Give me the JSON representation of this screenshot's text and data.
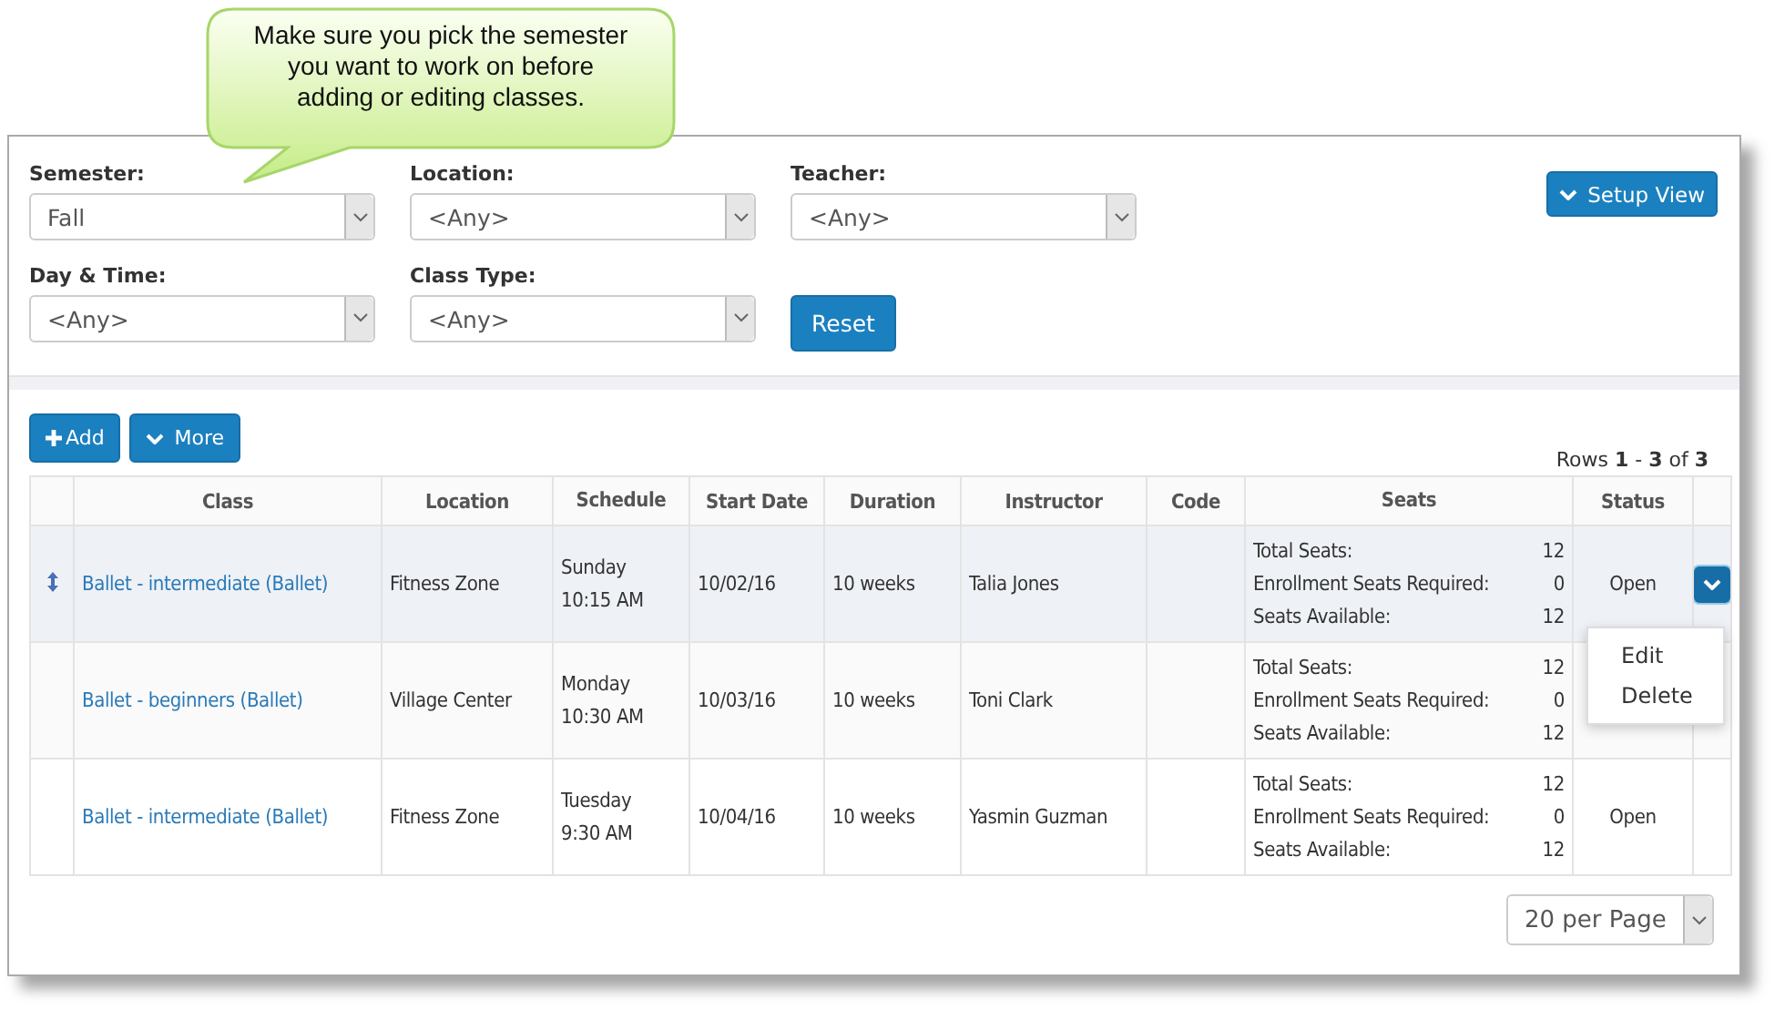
{
  "callout": {
    "text": "Make sure you pick the semester you want to work on before adding or editing classes."
  },
  "filters": [
    {
      "label": "Semester:",
      "value": "Fall"
    },
    {
      "label": "Location:",
      "value": "<Any>"
    },
    {
      "label": "Teacher:",
      "value": "<Any>"
    },
    {
      "label": "Day & Time:",
      "value": "<Any>"
    },
    {
      "label": "Class Type:",
      "value": "<Any>"
    }
  ],
  "reset_button": "Reset",
  "setup_view_button": "Setup View",
  "toolbar": {
    "add_button": "Add",
    "more_button": "More",
    "rows_info": "Rows **1** - **3** of **3**"
  },
  "table": {
    "columns": [
      "Class",
      "Location",
      "Schedule",
      "Start Date",
      "Duration",
      "Instructor",
      "Code",
      "Seats",
      "Status"
    ],
    "rows": [
      {
        "selected": true,
        "class": "Ballet - intermediate (Ballet)",
        "location": "Fitness Zone",
        "schedule": [
          "Sunday",
          "10:15 AM"
        ],
        "start_date": "10/02/16",
        "duration": "10 weeks",
        "instructor": "Talia Jones",
        "seats": [
          {
            "label": "Total Seats:",
            "value": "12"
          },
          {
            "label": "Enrollment Seats Required:",
            "value": "0"
          },
          {
            "label": "Seats Available:",
            "value": "12"
          }
        ],
        "status": "Open",
        "menu": {
          "expanded": true,
          "items": [
            "Edit",
            "Delete"
          ]
        }
      },
      {
        "selected": false,
        "class": "Ballet - beginners (Ballet)",
        "location": "Village Center",
        "schedule": [
          "Monday",
          "10:30 AM"
        ],
        "start_date": "10/03/16",
        "duration": "10 weeks",
        "instructor": "Toni Clark",
        "seats": [
          {
            "label": "Total Seats:",
            "value": "12"
          },
          {
            "label": "Enrollment Seats Required:",
            "value": "0"
          },
          {
            "label": "Seats Available:",
            "value": "12"
          }
        ]
      },
      {
        "selected": false,
        "class": "Ballet - intermediate (Ballet)",
        "location": "Fitness Zone",
        "schedule": [
          "Tuesday",
          "9:30 AM"
        ],
        "start_date": "10/04/16",
        "duration": "10 weeks",
        "instructor": "Yasmin Guzman",
        "seats": [
          {
            "label": "Total Seats:",
            "value": "12"
          },
          {
            "label": "Enrollment Seats Required:",
            "value": "0"
          },
          {
            "label": "Seats Available:",
            "value": "12"
          }
        ],
        "status": "Open"
      }
    ]
  },
  "pager": {
    "value": "20 per Page"
  }
}
